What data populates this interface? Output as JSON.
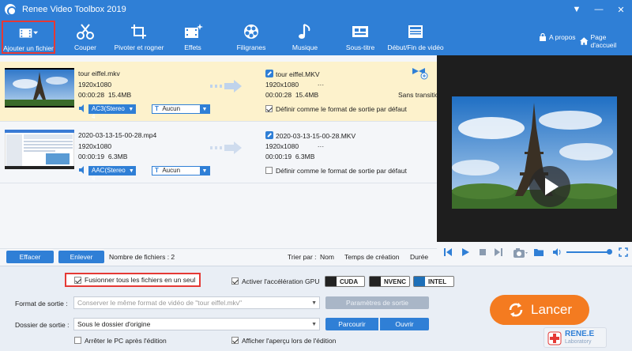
{
  "window": {
    "title": "Renee Video Toolbox 2019",
    "controls": [
      "▼",
      "—",
      "✕"
    ]
  },
  "toolbar": {
    "items": [
      {
        "label": "Ajouter un fichier",
        "icon": "add-file-icon"
      },
      {
        "label": "Couper",
        "icon": "scissors-icon"
      },
      {
        "label": "Pivoter et rogner",
        "icon": "crop-icon"
      },
      {
        "label": "Effets",
        "icon": "effects-icon"
      },
      {
        "label": "Filigranes",
        "icon": "watermark-icon"
      },
      {
        "label": "Musique",
        "icon": "music-icon"
      },
      {
        "label": "Sous-titre",
        "icon": "subtitle-icon"
      },
      {
        "label": "Début/Fin de vidéo",
        "icon": "intro-outro-icon"
      }
    ],
    "about": "A propos",
    "home": "Page d'accueil"
  },
  "files": [
    {
      "name": "tour eiffel.mkv",
      "resolution": "1920x1080",
      "duration": "00:00:28",
      "size": "15.4MB",
      "output_name": "tour eiffel.MKV",
      "output_resolution": "1920x1080",
      "output_extra": "···",
      "output_duration": "00:00:28",
      "output_size": "15.4MB",
      "audio": "AC3(Stereo 4",
      "subtitle": "Aucun",
      "default_format_label": "Définir comme le format de sortie par défaut",
      "default_checked": true,
      "transition": "Sans transitio"
    },
    {
      "name": "2020-03-13-15-00-28.mp4",
      "resolution": "1920x1080",
      "duration": "00:00:19",
      "size": "6.3MB",
      "output_name": "2020-03-13-15-00-28.MKV",
      "output_resolution": "1920x1080",
      "output_extra": "···",
      "output_duration": "00:00:19",
      "output_size": "6.3MB",
      "audio": "AAC(Stereo 4",
      "subtitle": "Aucun",
      "default_format_label": "Définir comme le format de sortie par défaut",
      "default_checked": false
    }
  ],
  "list_footer": {
    "clear": "Effacer",
    "remove": "Enlever",
    "count": "Nombre de fichiers : 2",
    "sort_by": "Trier par :",
    "sort_name": "Nom",
    "sort_created": "Temps de création",
    "sort_duration": "Durée"
  },
  "settings": {
    "merge": "Fusionner tous les fichiers en un seul",
    "merge_checked": true,
    "gpu": "Activer l'accélération GPU",
    "gpu_checked": true,
    "gpu_options": [
      "CUDA",
      "NVENC",
      "INTEL"
    ],
    "format_label": "Format de sortie :",
    "format_placeholder": "Conserver le même format de vidéo de \"tour eiffel.mkv\"",
    "params_button": "Paramètres de sortie",
    "folder_label": "Dossier de sortie :",
    "folder_value": "Sous le dossier d'origine",
    "browse": "Parcourir",
    "open": "Ouvrir",
    "shutdown": "Arrêter le PC après l'édition",
    "shutdown_checked": false,
    "preview_edit": "Afficher l'aperçu lors de l'édition",
    "preview_checked": true,
    "launch": "Lancer"
  },
  "brand": {
    "name": "RENE.E",
    "sub": "Laboratory"
  },
  "colors": {
    "accent": "#2f7fd6",
    "launch": "#f47b20",
    "highlight": "#e53935"
  }
}
